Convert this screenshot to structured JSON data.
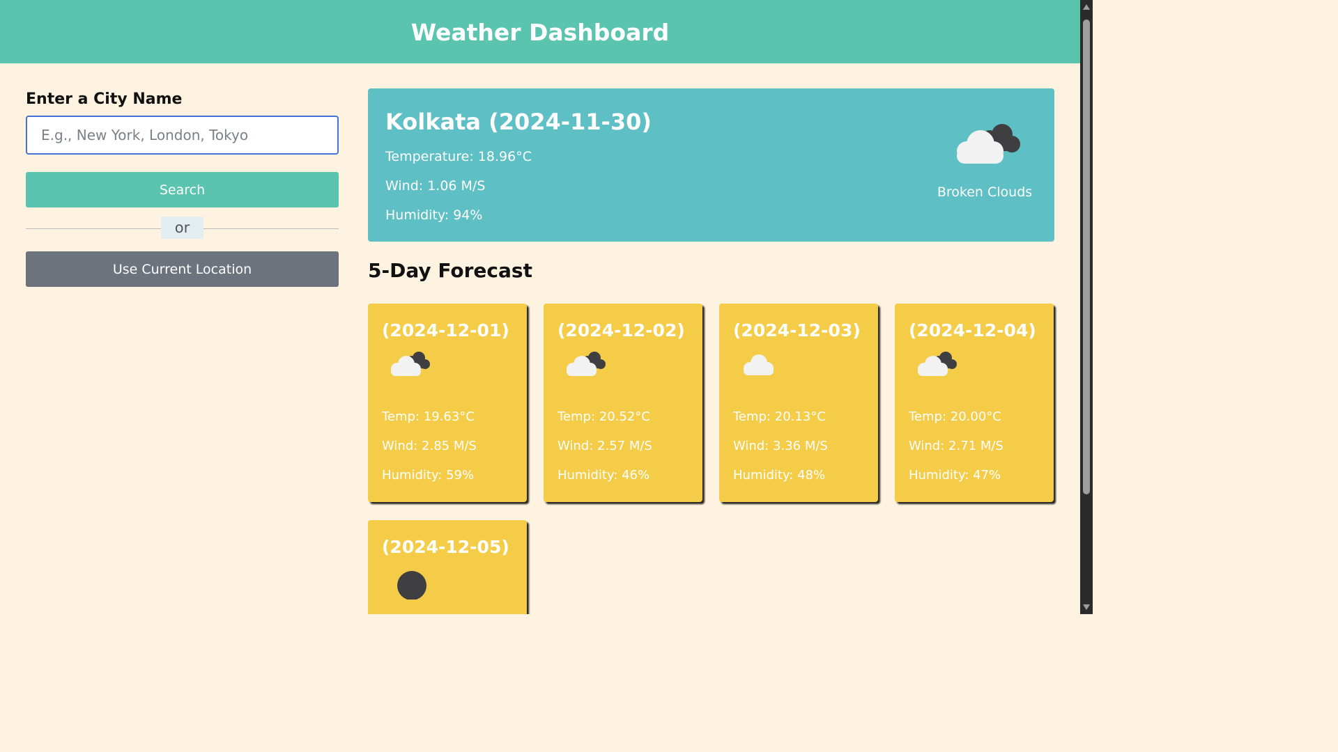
{
  "header": {
    "title": "Weather Dashboard"
  },
  "sidebar": {
    "label": "Enter a City Name",
    "input_placeholder": "E.g., New York, London, Tokyo",
    "input_value": "",
    "search_label": "Search",
    "divider_text": "or",
    "location_label": "Use Current Location"
  },
  "current": {
    "title": "Kolkata (2024-11-30)",
    "temperature": "Temperature: 18.96°C",
    "wind": "Wind: 1.06 M/S",
    "humidity": "Humidity: 94%",
    "icon": "broken-clouds-icon",
    "description": "Broken Clouds"
  },
  "forecast": {
    "title": "5-Day Forecast",
    "days": [
      {
        "date": "(2024-12-01)",
        "icon": "broken-clouds-icon",
        "temp": "Temp: 19.63°C",
        "wind": "Wind: 2.85 M/S",
        "humidity": "Humidity: 59%"
      },
      {
        "date": "(2024-12-02)",
        "icon": "broken-clouds-icon",
        "temp": "Temp: 20.52°C",
        "wind": "Wind: 2.57 M/S",
        "humidity": "Humidity: 46%"
      },
      {
        "date": "(2024-12-03)",
        "icon": "cloud-icon",
        "temp": "Temp: 20.13°C",
        "wind": "Wind: 3.36 M/S",
        "humidity": "Humidity: 48%"
      },
      {
        "date": "(2024-12-04)",
        "icon": "broken-clouds-icon",
        "temp": "Temp: 20.00°C",
        "wind": "Wind: 2.71 M/S",
        "humidity": "Humidity: 47%"
      },
      {
        "date": "(2024-12-05)",
        "icon": "dark-circle-icon"
      }
    ]
  },
  "colors": {
    "header": "#5bc4ae",
    "background": "#fdf3e0",
    "current_card": "#5ebfc4",
    "forecast_card": "#f5cc48",
    "location_button": "#6d737c",
    "input_border": "#4a6fd8"
  }
}
